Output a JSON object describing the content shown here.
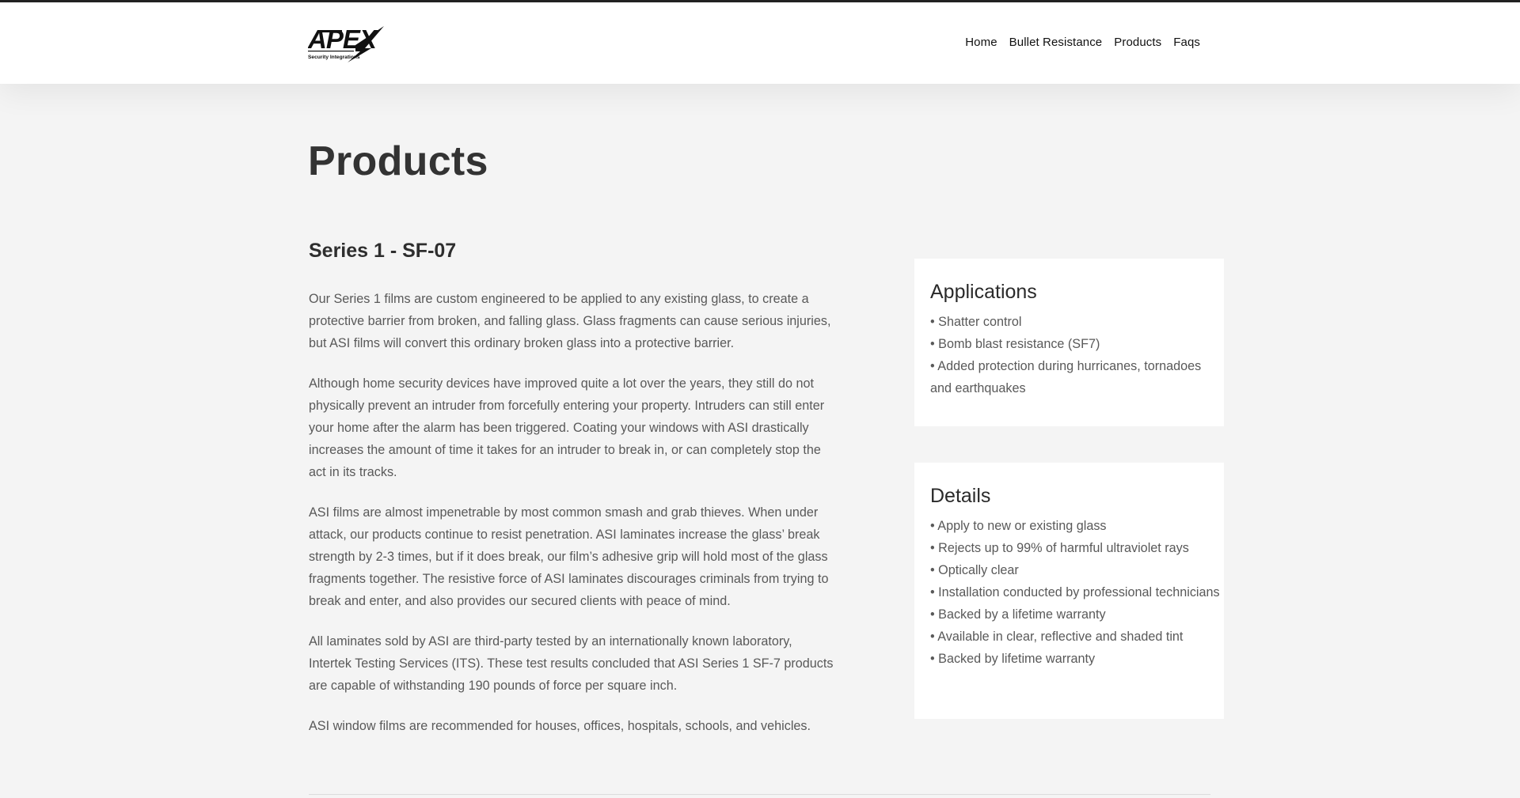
{
  "header": {
    "logo": {
      "brand": "APEX",
      "tagline": "Security Integrations"
    },
    "nav": [
      {
        "label": "Home"
      },
      {
        "label": "Bullet Resistance"
      },
      {
        "label": "Products"
      },
      {
        "label": "Faqs"
      }
    ]
  },
  "page": {
    "title": "Products",
    "series_title": "Series 1 - SF-07",
    "paragraphs": [
      "Our Series 1 films are custom engineered to be applied to any existing glass, to create a protective barrier from broken, and falling glass. Glass fragments can cause serious injuries, but ASI films will convert this ordinary broken glass into a protective barrier.",
      "Although home security devices have improved quite a lot over the years, they still do not physically prevent an intruder from forcefully entering your property. Intruders can still enter your home after the alarm has been triggered. Coating your windows with ASI drastically increases the amount of time it takes for an intruder to break in, or can completely stop the act in its tracks.",
      "ASI films are almost impenetrable by most common smash and grab thieves. When under attack, our products continue to resist penetration. ASI laminates increase the glass’ break strength by 2-3 times, but if it does break, our film’s adhesive grip will hold most of the glass fragments together. The resistive force of ASI laminates discourages criminals from trying to break and enter, and also provides our secured clients with peace of mind.",
      "All laminates sold by ASI are third-party tested by an internationally known laboratory, Intertek Testing Services (ITS). These test results concluded that ASI Series 1 SF-7 products are capable of withstanding 190 pounds of force per square inch.",
      "ASI window films are recommended for houses, offices, hospitals, schools, and vehicles."
    ]
  },
  "sidebar": {
    "applications": {
      "title": "Applications",
      "items": [
        "• Shatter control",
        "• Bomb blast resistance (SF7)",
        "• Added protection during hurricanes, tornadoes and earthquakes"
      ]
    },
    "details": {
      "title": "Details",
      "items": [
        "• Apply to new or existing glass",
        "• Rejects up to 99% of harmful ultraviolet rays",
        "• Optically clear",
        "• Installation conducted by professional technicians",
        "• Backed by a lifetime warranty",
        "• Available in clear, reflective and shaded tint",
        "• Backed by lifetime warranty"
      ]
    }
  }
}
